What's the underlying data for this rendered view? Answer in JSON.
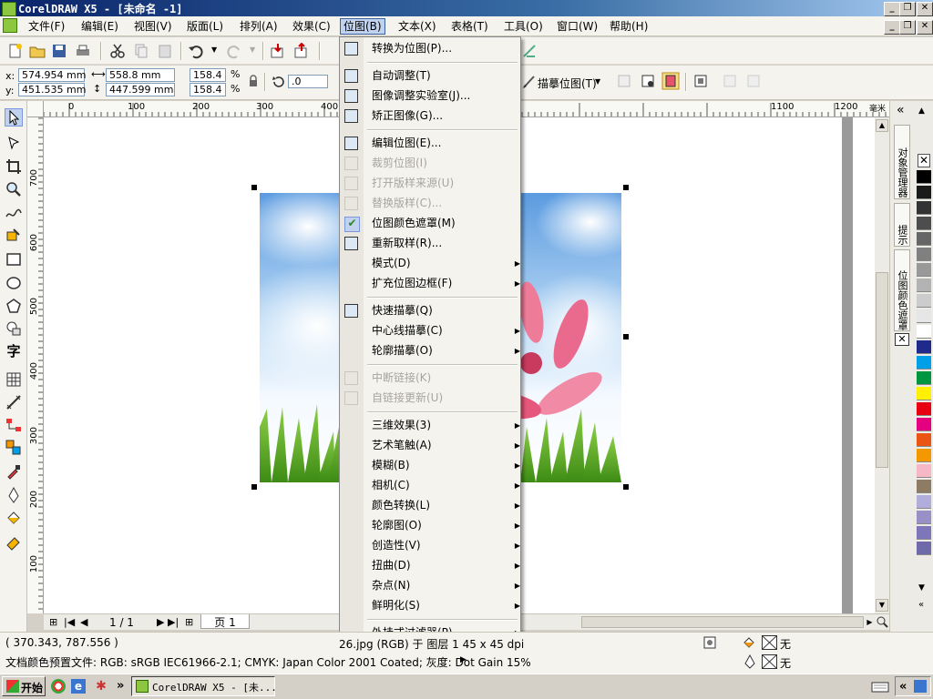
{
  "window": {
    "title": "CorelDRAW X5 - [未命名 -1]",
    "doc_buttons": [
      "_",
      "❐",
      "✕"
    ]
  },
  "menubar": {
    "items": [
      "文件(F)",
      "编辑(E)",
      "视图(V)",
      "版面(L)",
      "排列(A)",
      "效果(C)",
      "位图(B)",
      "文本(X)",
      "表格(T)",
      "工具(O)",
      "窗口(W)",
      "帮助(H)"
    ],
    "active": "位图(B)"
  },
  "toolbar2": {
    "x": "574.954 mm",
    "y": "451.535 mm",
    "x_label": "x:",
    "y_label": "y:",
    "width": "558.8 mm",
    "height": "447.599 mm",
    "scale_x": "158.4",
    "scale_y": "158.4",
    "percent": "%",
    "rotation": ".0",
    "trace_label": "描摹位图(T)"
  },
  "rulers": {
    "h_ticks": [
      "0",
      "100",
      "200",
      "300",
      "400",
      "1100",
      "1200"
    ],
    "h_unit": "毫米",
    "v_ticks": [
      "700",
      "600",
      "500",
      "400",
      "300",
      "200",
      "100"
    ]
  },
  "bitmap_menu": {
    "items": [
      {
        "label": "转换为位图(P)...",
        "disabled": false,
        "submenu": false
      },
      {
        "sep": true
      },
      {
        "label": "自动调整(T)",
        "disabled": false,
        "submenu": false
      },
      {
        "label": "图像调整实验室(J)...",
        "disabled": false,
        "submenu": false
      },
      {
        "label": "矫正图像(G)...",
        "disabled": false,
        "submenu": false
      },
      {
        "sep": true
      },
      {
        "label": "编辑位图(E)...",
        "disabled": false,
        "submenu": false
      },
      {
        "label": "裁剪位图(I)",
        "disabled": true,
        "submenu": false
      },
      {
        "label": "打开版样来源(U)",
        "disabled": true,
        "submenu": false
      },
      {
        "label": "替换版样(C)...",
        "disabled": true,
        "submenu": false
      },
      {
        "label": "位图颜色遮罩(M)",
        "disabled": false,
        "submenu": false
      },
      {
        "label": "重新取样(R)...",
        "disabled": false,
        "submenu": false
      },
      {
        "label": "模式(D)",
        "disabled": false,
        "submenu": true
      },
      {
        "label": "扩充位图边框(F)",
        "disabled": false,
        "submenu": true
      },
      {
        "sep": true
      },
      {
        "label": "快速描摹(Q)",
        "disabled": false,
        "submenu": false
      },
      {
        "label": "中心线描摹(C)",
        "disabled": false,
        "submenu": true
      },
      {
        "label": "轮廓描摹(O)",
        "disabled": false,
        "submenu": true
      },
      {
        "sep": true
      },
      {
        "label": "中断链接(K)",
        "disabled": true,
        "submenu": false
      },
      {
        "label": "自链接更新(U)",
        "disabled": true,
        "submenu": false
      },
      {
        "sep": true
      },
      {
        "label": "三维效果(3)",
        "disabled": false,
        "submenu": true
      },
      {
        "label": "艺术笔触(A)",
        "disabled": false,
        "submenu": true
      },
      {
        "label": "模糊(B)",
        "disabled": false,
        "submenu": true
      },
      {
        "label": "相机(C)",
        "disabled": false,
        "submenu": true
      },
      {
        "label": "颜色转换(L)",
        "disabled": false,
        "submenu": true
      },
      {
        "label": "轮廓图(O)",
        "disabled": false,
        "submenu": true
      },
      {
        "label": "创造性(V)",
        "disabled": false,
        "submenu": true
      },
      {
        "label": "扭曲(D)",
        "disabled": false,
        "submenu": true
      },
      {
        "label": "杂点(N)",
        "disabled": false,
        "submenu": true
      },
      {
        "label": "鲜明化(S)",
        "disabled": false,
        "submenu": true
      },
      {
        "sep": true
      },
      {
        "label": "外挂式过滤器(P)",
        "disabled": false,
        "submenu": true
      }
    ]
  },
  "page_nav": {
    "counter": "1 / 1",
    "page_tab": "页 1"
  },
  "docker_tabs": [
    "对象管理器",
    "提示",
    "位图颜色遮罩"
  ],
  "palette": [
    "#000000",
    "#1a1a1a",
    "#333333",
    "#4d4d4d",
    "#666666",
    "#808080",
    "#999999",
    "#b3b3b3",
    "#cccccc",
    "#e6e6e6",
    "#ffffff",
    "#1f2a8a",
    "#00a0e9",
    "#00963f",
    "#fff100",
    "#e60012",
    "#e4007f",
    "#ea5514",
    "#f39800",
    "#f6b8c4",
    "#8d7b64",
    "#b2aedb",
    "#9a90c8",
    "#7d77b9",
    "#6f6aa8"
  ],
  "status": {
    "coords": "( 370.343, 787.556 )",
    "object_info": "26.jpg (RGB) 于 图层 1 45 x 45 dpi",
    "profile": "文档颜色预置文件: RGB: sRGB IEC61966-2.1; CMYK: Japan Color 2001 Coated; 灰度: Dot Gain 15%",
    "fill": "无",
    "outline": "无"
  },
  "taskbar": {
    "start": "开始",
    "task": "CorelDRAW X5 - [未...",
    "chevron": "»"
  }
}
